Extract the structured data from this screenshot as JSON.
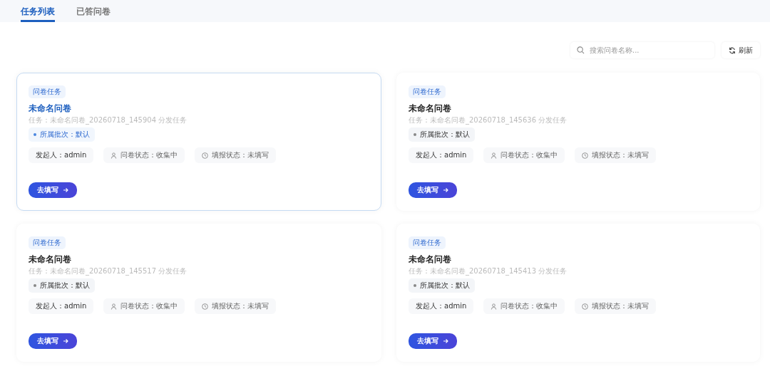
{
  "tabs": [
    {
      "label": "任务列表",
      "selected": true
    },
    {
      "label": "已答问卷",
      "selected": false
    }
  ],
  "search": {
    "placeholder": "搜索问卷名称..."
  },
  "refresh_button": {
    "label": "刷新"
  },
  "cards": [
    {
      "selected": true,
      "tag": "问卷任务",
      "title": "未命名问卷",
      "subtitle": "任务：未命名问卷_20260718_145904 分发任务",
      "batch": "所属批次：默认",
      "initiator": "发起人：admin",
      "survey_status": "问卷状态：收集中",
      "fill_status": "填报状态：未填写",
      "action": "去填写"
    },
    {
      "selected": false,
      "tag": "问卷任务",
      "title": "未命名问卷",
      "subtitle": "任务：未命名问卷_20260718_145636 分发任务",
      "batch": "所属批次：默认",
      "initiator": "发起人：admin",
      "survey_status": "问卷状态：收集中",
      "fill_status": "填报状态：未填写",
      "action": "去填写"
    },
    {
      "selected": false,
      "tag": "问卷任务",
      "title": "未命名问卷",
      "subtitle": "任务：未命名问卷_20260718_145517 分发任务",
      "batch": "所属批次：默认",
      "initiator": "发起人：admin",
      "survey_status": "问卷状态：收集中",
      "fill_status": "填报状态：未填写",
      "action": "去填写"
    },
    {
      "selected": false,
      "tag": "问卷任务",
      "title": "未命名问卷",
      "subtitle": "任务：未命名问卷_20260718_145413 分发任务",
      "batch": "所属批次：默认",
      "initiator": "发起人：admin",
      "survey_status": "问卷状态：收集中",
      "fill_status": "填报状态：未填写",
      "action": "去填写"
    }
  ]
}
